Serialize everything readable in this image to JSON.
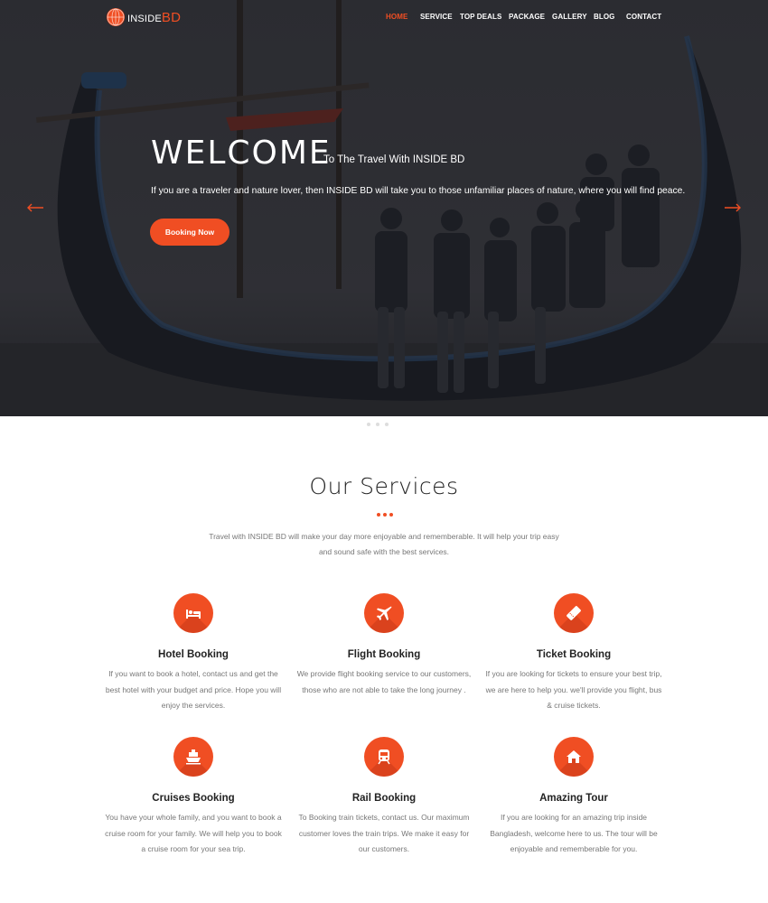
{
  "brand": {
    "prefix": "INSIDE",
    "suffix": "BD"
  },
  "nav": [
    "HOME",
    "SERVICE",
    "TOP DEALS",
    "PACKAGE",
    "GALLERY",
    "BLOG",
    "CONTACT"
  ],
  "hero": {
    "title": "WELCOME",
    "subtitle": "To The Travel With INSIDE BD",
    "description": "If you are a traveler and nature lover, then INSIDE BD will take you to those unfamiliar places of nature, where you will find peace.",
    "button": "Booking Now"
  },
  "services": {
    "title": "Our Services",
    "intro": "Travel with INSIDE BD will make your day more enjoyable and rememberable. It will help your trip easy and sound safe with the best services.",
    "items": [
      {
        "title": "Hotel Booking",
        "text": "If you want to book a hotel, contact us and get the best hotel with your budget and price. Hope you will enjoy the services.",
        "icon": "bed-icon"
      },
      {
        "title": "Flight Booking",
        "text": "We provide flight booking service to our customers, those who are not able to take the long journey .",
        "icon": "plane-icon"
      },
      {
        "title": "Ticket Booking",
        "text": "If you are looking for tickets to ensure your best trip, we are here to help you. we'll provide you flight, bus & cruise tickets.",
        "icon": "ticket-icon"
      },
      {
        "title": "Cruises Booking",
        "text": "You have your whole family, and you want to book a cruise room for your family. We will help you to book a cruise room for your sea trip.",
        "icon": "ship-icon"
      },
      {
        "title": "Rail Booking",
        "text": "To Booking train tickets, contact us. Our maximum customer loves the train trips. We make it easy for our customers.",
        "icon": "train-icon"
      },
      {
        "title": "Amazing Tour",
        "text": "If you are looking for an amazing trip inside Bangladesh, welcome here to us. The tour will be enjoyable and rememberable for you.",
        "icon": "home-icon"
      }
    ]
  },
  "colors": {
    "accent": "#f04e23",
    "hero_bg": "#2c2d31"
  }
}
